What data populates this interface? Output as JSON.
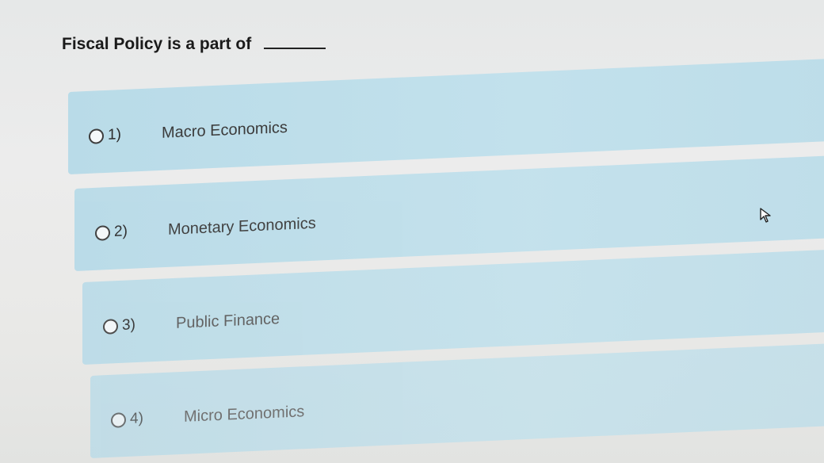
{
  "question": {
    "text": "Fiscal Policy is a part of"
  },
  "options": [
    {
      "number": "1)",
      "label": "Macro Economics"
    },
    {
      "number": "2)",
      "label": "Monetary Economics"
    },
    {
      "number": "3)",
      "label": "Public Finance"
    },
    {
      "number": "4)",
      "label": "Micro Economics"
    }
  ],
  "icons": {
    "radio": "radio-circle-icon",
    "cursor": "mouse-pointer-icon"
  },
  "colors": {
    "option_background": "#bfdfeb",
    "page_background": "#e9e9e9",
    "question_text": "#1a1a1a"
  }
}
